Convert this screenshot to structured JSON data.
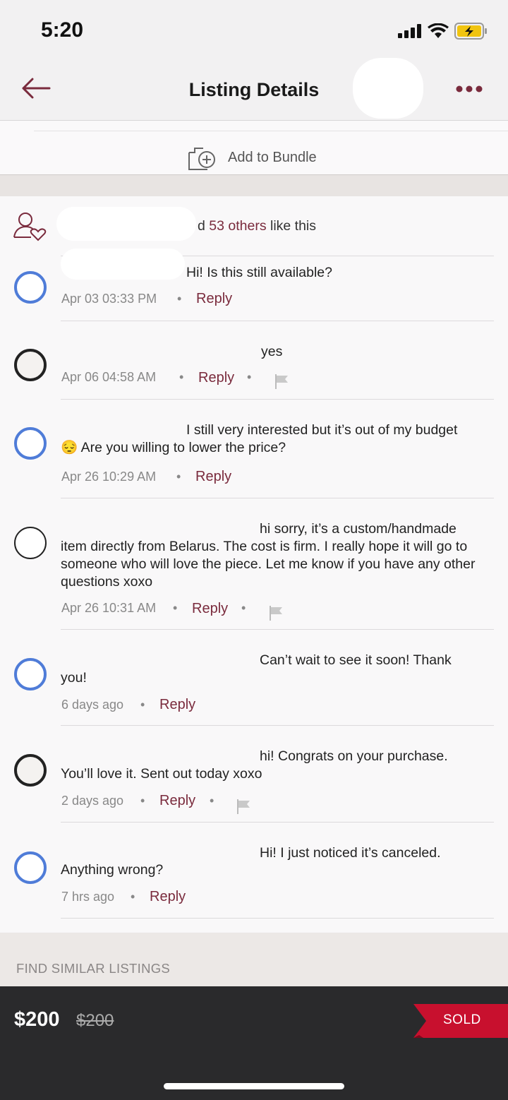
{
  "status_bar": {
    "time": "5:20"
  },
  "header": {
    "title": "Listing Details"
  },
  "bundle": {
    "label": "Add to Bundle"
  },
  "likes": {
    "prefix": "d ",
    "count": "53 others",
    "suffix": " like this"
  },
  "comments": [
    {
      "text": "Hi! Is this still available?",
      "time": "Apr 03 03:33 PM",
      "reply": "Reply"
    },
    {
      "text": "yes",
      "time": "Apr 06 04:58 AM",
      "reply": "Reply"
    },
    {
      "text_line1": "I still very interested but it’s out of my budget",
      "emoji": "😔",
      "text_line2": "Are you willing to lower the price?",
      "time": "Apr 26 10:29 AM",
      "reply": "Reply"
    },
    {
      "text_line1": "hi sorry, it’s a custom/handmade",
      "text_rest": "item directly from Belarus. The cost is firm. I really hope it will go to someone who will love the piece. Let me know if you have any other questions xoxo",
      "time": "Apr 26 10:31 AM",
      "reply": "Reply"
    },
    {
      "text_line1": "Can’t wait to see it soon! Thank",
      "text_line2": "you!",
      "time": "6 days ago",
      "reply": "Reply"
    },
    {
      "text_line1": "hi! Congrats on your purchase.",
      "text_line2": "You’ll love it. Sent out today xoxo",
      "time": "2 days ago",
      "reply": "Reply"
    },
    {
      "text_line1": "Hi! I just noticed it’s canceled.",
      "text_line2": "Anything wrong?",
      "time": "7 hrs ago",
      "reply": "Reply"
    }
  ],
  "find_similar": {
    "label": "FIND SIMILAR LISTINGS"
  },
  "bottom_bar": {
    "price": "$200",
    "original_price": "$200",
    "status": "SOLD"
  },
  "colors": {
    "accent": "#7a2b3d",
    "sold_red": "#c8102e",
    "avatar_blue": "#4f7cd8"
  },
  "icons": [
    "back-arrow-icon",
    "more-icon",
    "add-bundle-icon",
    "likes-icon",
    "flag-icon",
    "signal-icon",
    "wifi-icon",
    "battery-icon"
  ]
}
